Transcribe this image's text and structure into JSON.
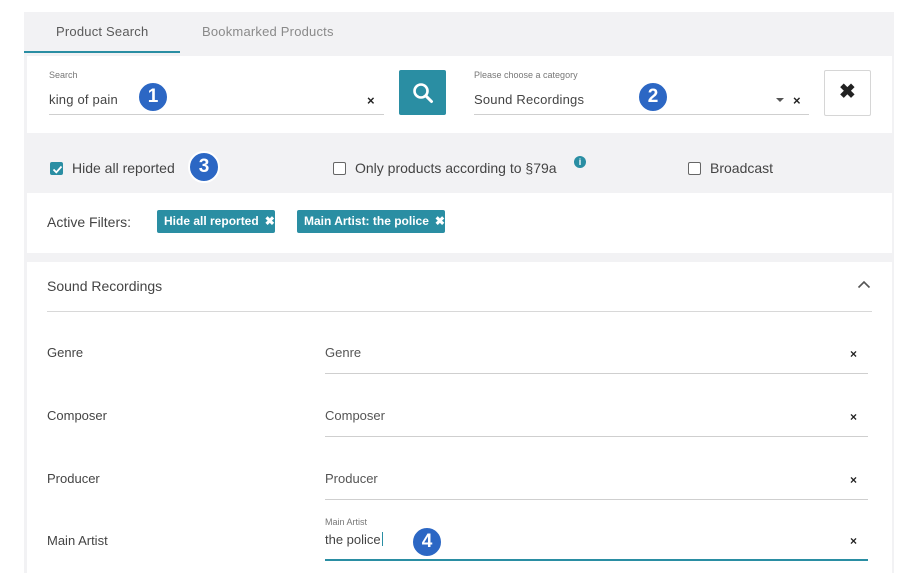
{
  "tabs": [
    {
      "label": "Product Search",
      "active": true
    },
    {
      "label": "Bookmarked Products",
      "active": false
    }
  ],
  "search": {
    "label": "Search",
    "value": "king of pain",
    "clear": "×"
  },
  "category": {
    "label": "Please choose a category",
    "value": "Sound Recordings",
    "clear": "×"
  },
  "reset_button": {
    "icon": "close-icon",
    "glyph": "✖"
  },
  "search_button": {
    "icon": "search-icon"
  },
  "badges": [
    "1",
    "2",
    "3",
    "4"
  ],
  "options": {
    "hide_reported": {
      "label": "Hide all reported",
      "checked": true
    },
    "only_79a": {
      "label": "Only products according to §79a",
      "checked": false,
      "info": "i"
    },
    "broadcast": {
      "label": "Broadcast",
      "checked": false
    }
  },
  "active_filters": {
    "label": "Active Filters:",
    "chips": [
      {
        "label": "Hide all reported",
        "remove": "✖"
      },
      {
        "label": "Main Artist: the police",
        "remove": "✖"
      }
    ]
  },
  "panel": {
    "title": "Sound Recordings",
    "rows": [
      {
        "label": "Genre",
        "placeholder": "Genre",
        "value": "",
        "clear": "×"
      },
      {
        "label": "Composer",
        "placeholder": "Composer",
        "value": "",
        "clear": "×"
      },
      {
        "label": "Producer",
        "placeholder": "Producer",
        "value": "",
        "clear": "×"
      },
      {
        "label": "Main Artist",
        "mini_label": "Main Artist",
        "value": "the police",
        "clear": "×"
      }
    ]
  },
  "colors": {
    "accent": "#2a8ea3",
    "badge": "#2c67c4",
    "background": "#f2f2f4"
  }
}
